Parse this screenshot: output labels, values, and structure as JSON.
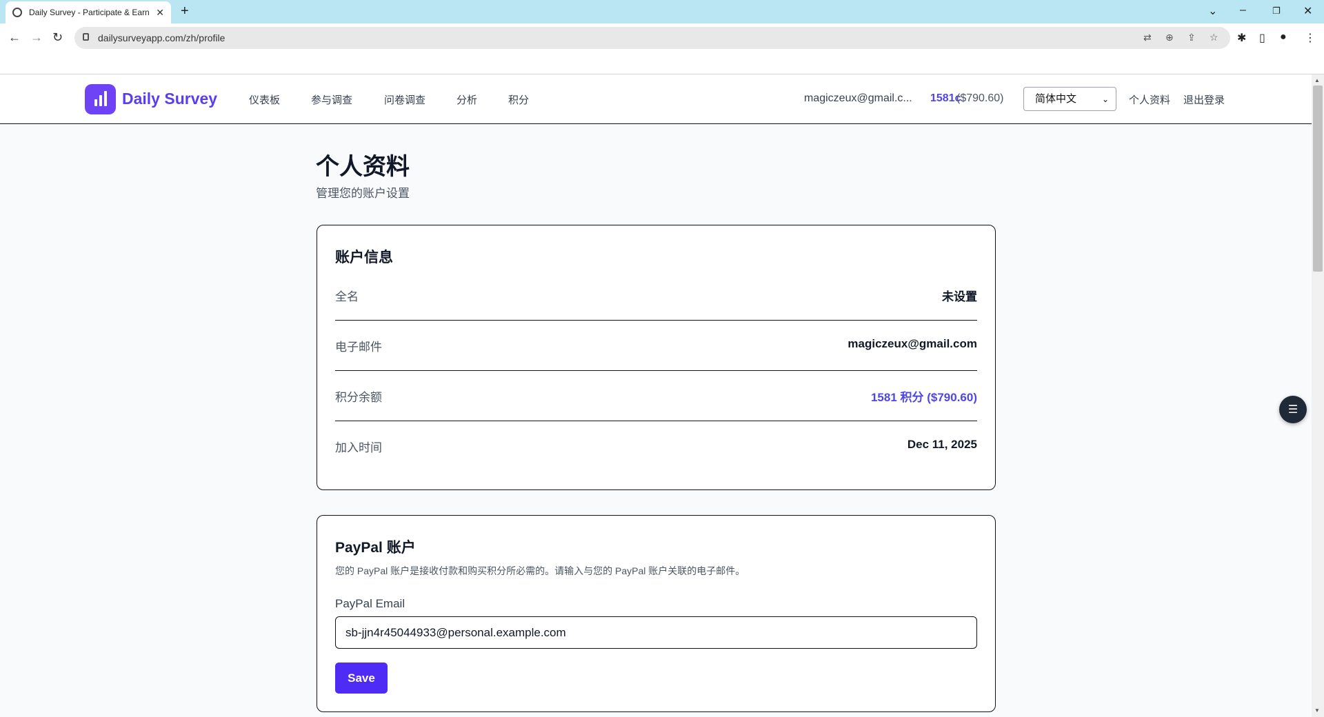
{
  "browser": {
    "tab_title": "Daily Survey - Participate & Earn",
    "close_glyph": "✕",
    "new_tab_glyph": "+",
    "url": "dailysurveyapp.com/zh/profile"
  },
  "header": {
    "brand": "Daily Survey",
    "nav": [
      "仪表板",
      "参与调查",
      "问卷调查",
      "分析",
      "积分"
    ],
    "email": "magiczeux@gmail.c...",
    "points": "1581c",
    "points_usd": "($790.60)",
    "language": "简体中文",
    "profile_link": "个人资料",
    "logout_link": "退出登录"
  },
  "page": {
    "title": "个人资料",
    "subtitle": "管理您的账户设置"
  },
  "account": {
    "title": "账户信息",
    "rows": [
      {
        "label": "全名",
        "value": "未设置"
      },
      {
        "label": "电子邮件",
        "value": "magiczeux@gmail.com"
      },
      {
        "label": "积分余额",
        "value": "1581 积分 ($790.60)"
      },
      {
        "label": "加入时间",
        "value": "Dec 11, 2025"
      }
    ]
  },
  "paypal": {
    "title": "PayPal 账户",
    "description": "您的 PayPal 账户是接收付款和购买积分所必需的。请输入与您的 PayPal 账户关联的电子邮件。",
    "field_label": "PayPal Email",
    "field_value": "sb-jjn4r45044933@personal.example.com",
    "save_label": "Save"
  },
  "colors": {
    "brand": "#6d43f5",
    "accent": "#4f46e5",
    "button": "#4f2cf5"
  }
}
